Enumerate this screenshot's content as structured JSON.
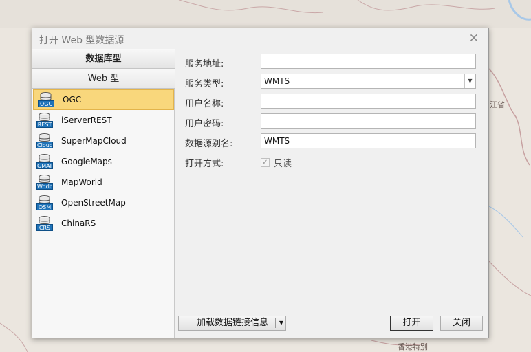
{
  "map": {
    "label_province": "江省",
    "label_hk": "香港特别"
  },
  "dialog": {
    "title": "打开 Web 型数据源",
    "close_glyph": "✕"
  },
  "categories": {
    "database": "数据库型",
    "web": "Web 型"
  },
  "sources": [
    {
      "label": "OGC",
      "tag": "OGC",
      "selected": true
    },
    {
      "label": "iServerREST",
      "tag": "REST",
      "selected": false
    },
    {
      "label": "SuperMapCloud",
      "tag": "Cloud",
      "selected": false
    },
    {
      "label": "GoogleMaps",
      "tag": "GMAP",
      "selected": false
    },
    {
      "label": "MapWorld",
      "tag": "World",
      "selected": false
    },
    {
      "label": "OpenStreetMap",
      "tag": "OSM",
      "selected": false
    },
    {
      "label": "ChinaRS",
      "tag": "CRS",
      "selected": false
    }
  ],
  "form": {
    "service_address_label": "服务地址:",
    "service_address_value": "",
    "service_type_label": "服务类型:",
    "service_type_value": "WMTS",
    "username_label": "用户名称:",
    "username_value": "",
    "password_label": "用户密码:",
    "password_value": "",
    "alias_label": "数据源别名:",
    "alias_value": "WMTS",
    "open_mode_label": "打开方式:",
    "readonly_label": "只读",
    "readonly_checked": true
  },
  "buttons": {
    "load_label": "加载数据链接信息",
    "open_label": "打开",
    "cancel_label": "关闭"
  },
  "colors": {
    "selected_bg": "#f9d77c",
    "icon_tag": "#1f73b8"
  }
}
